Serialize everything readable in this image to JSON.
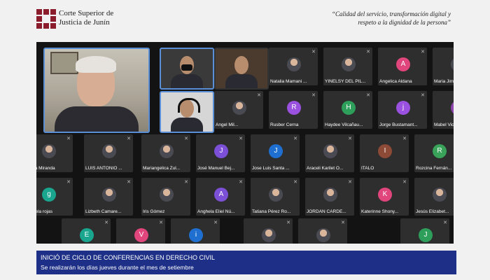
{
  "header": {
    "org_line1": "Corte Superior de",
    "org_line2": "Justicia de Junín",
    "motto_line1": "“Calidad del servicio, transformación digital y",
    "motto_line2": "respeto a la dignidad de la persona”"
  },
  "colors": {
    "logo": "#8a1c2b",
    "banner": "#1d2f86",
    "active_speaker": "#5a8fd8",
    "tile_bg": "#2e2e2e"
  },
  "participants": [
    {
      "name": "Natalia Mamani ...",
      "type": "photo",
      "color": "#4a4a52"
    },
    {
      "name": "YINELSY DEL PIL...",
      "type": "photo",
      "color": "#4a4a52"
    },
    {
      "name": "Angelica Aldana",
      "type": "letter",
      "letter": "A",
      "color": "#e0457b"
    },
    {
      "name": "Maria Jiménez",
      "type": "photo",
      "color": "#4a4a52"
    },
    {
      "name": "Angel Mil...",
      "type": "photo",
      "color": "#4a4a52"
    },
    {
      "name": "Rusber Cerna",
      "type": "letter",
      "letter": "R",
      "color": "#9b51e0"
    },
    {
      "name": "Haydee Vilcañau...",
      "type": "letter",
      "letter": "H",
      "color": "#2e9e5b"
    },
    {
      "name": "Jorge Bustamant...",
      "type": "letter",
      "letter": "j",
      "color": "#9b51e0"
    },
    {
      "name": "Mabel Victoria",
      "type": "letter",
      "letter": "M",
      "color": "#8e44ad"
    },
    {
      "name": "Gloria Miranda",
      "type": "photo",
      "color": "#4a4a52"
    },
    {
      "name": "LUIS ANTONIO ...",
      "type": "photo",
      "color": "#4a4a52"
    },
    {
      "name": "Mariangelica Zul...",
      "type": "photo",
      "color": "#4a4a52"
    },
    {
      "name": "José Manuel Bej...",
      "type": "letter",
      "letter": "J",
      "color": "#7b4fd6"
    },
    {
      "name": "Jose Luis Santa ...",
      "type": "letter",
      "letter": "J",
      "color": "#1f6fd1"
    },
    {
      "name": "Araceli Karilet O...",
      "type": "photo",
      "color": "#4a4a52"
    },
    {
      "name": "ITALO",
      "type": "letter",
      "letter": "I",
      "color": "#8d4a36"
    },
    {
      "name": "Rozcina Fernán...",
      "type": "letter",
      "letter": "R",
      "color": "#3aa35a"
    },
    {
      "name": "gabriela rojas",
      "type": "letter",
      "letter": "g",
      "color": "#1aa58f"
    },
    {
      "name": "Lizbeth Camare...",
      "type": "photo",
      "color": "#4a4a52"
    },
    {
      "name": "Iris Gómez",
      "type": "photo",
      "color": "#4a4a52"
    },
    {
      "name": "Anghela Eliel Nú...",
      "type": "letter",
      "letter": "A",
      "color": "#7b4fd6"
    },
    {
      "name": "Tatiana Pérez Ro...",
      "type": "photo",
      "color": "#4a4a52"
    },
    {
      "name": "JORDAN CARDE...",
      "type": "photo",
      "color": "#4a4a52"
    },
    {
      "name": "Katerinne Shony...",
      "type": "letter",
      "letter": "K",
      "color": "#e0457b"
    },
    {
      "name": "Jesús Elizabet...",
      "type": "photo",
      "color": "#4a4a52"
    },
    {
      "name": "",
      "type": "letter",
      "letter": "E",
      "color": "#1aa58f"
    },
    {
      "name": "",
      "type": "letter",
      "letter": "V",
      "color": "#e0457b"
    },
    {
      "name": "",
      "type": "letter",
      "letter": "i",
      "color": "#1f6fd1"
    },
    {
      "name": "",
      "type": "photo",
      "color": "#4a4a52"
    },
    {
      "name": "",
      "type": "photo",
      "color": "#4a4a52"
    },
    {
      "name": "",
      "type": "letter",
      "letter": "J",
      "color": "#2e9e5b"
    }
  ],
  "banner": {
    "title": "INICIÓ DE CICLO DE CONFERENCIAS EN DERECHO CIVIL",
    "subtitle": "Se realizarán los días jueves durante el mes de setiembre"
  }
}
